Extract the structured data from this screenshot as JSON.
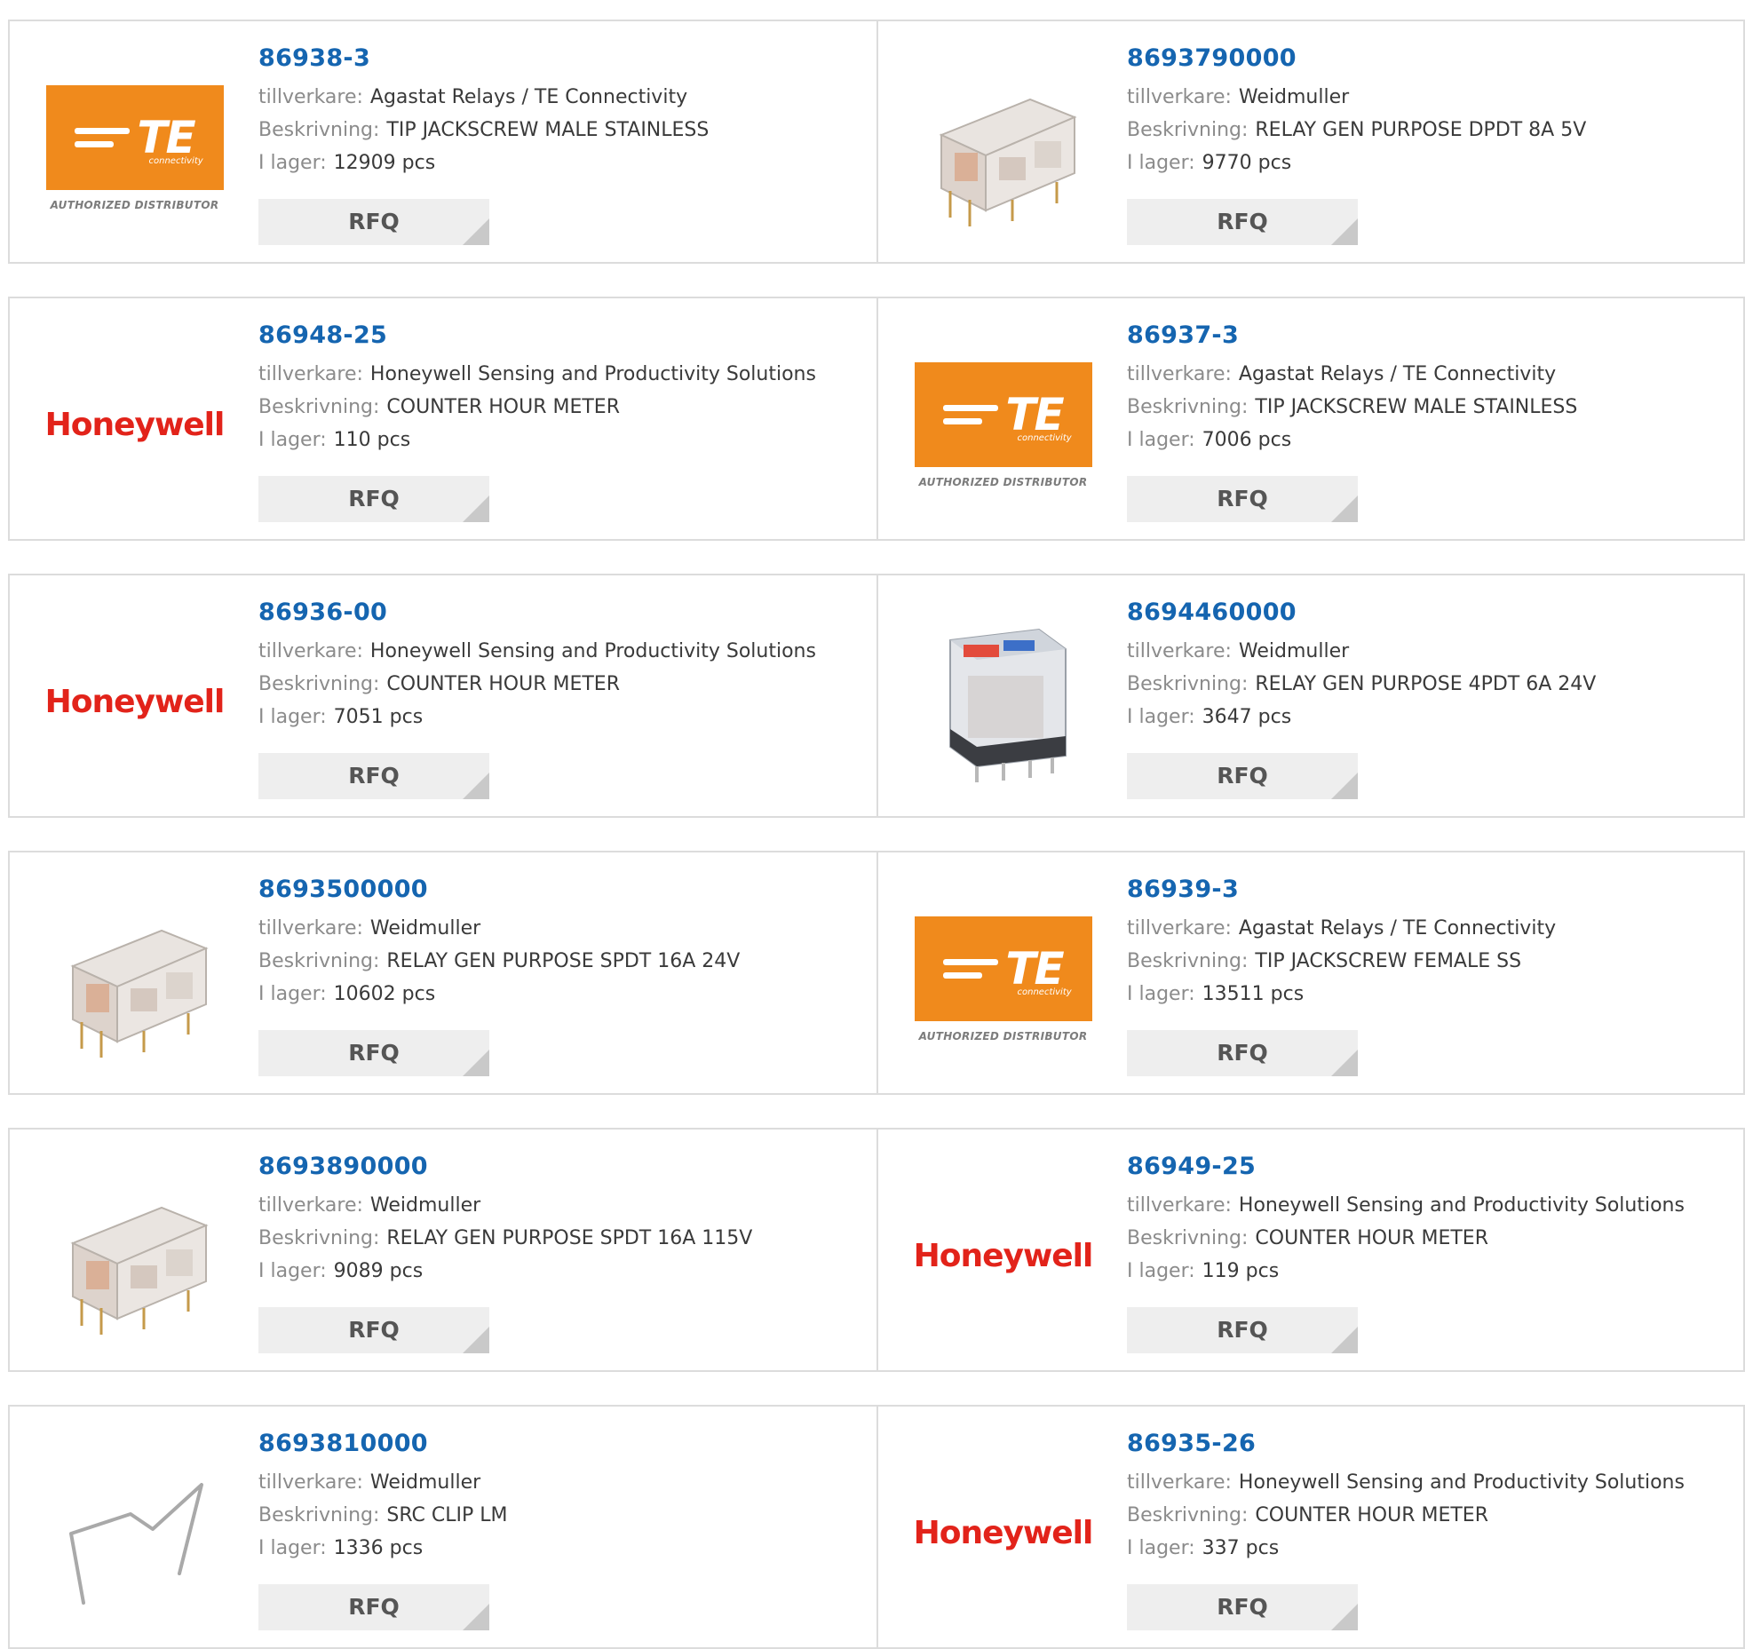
{
  "labels": {
    "manufacturer": "tillverkare:",
    "description": "Beskrivning:",
    "stock": "I lager:",
    "rfq": "RFQ"
  },
  "logos": {
    "te_text": "TE",
    "te_sub": "connectivity",
    "te_authorized": "AUTHORIZED DISTRIBUTOR",
    "honeywell": "Honeywell"
  },
  "products": [
    {
      "part": "86938-3",
      "manufacturer": "Agastat Relays / TE Connectivity",
      "description": "TIP JACKSCREW MALE STAINLESS",
      "stock": "12909 pcs",
      "image": "te-logo"
    },
    {
      "part": "8693790000",
      "manufacturer": "Weidmuller",
      "description": "RELAY GEN PURPOSE DPDT 8A 5V",
      "stock": "9770 pcs",
      "image": "relay-clear"
    },
    {
      "part": "86948-25",
      "manufacturer": "Honeywell Sensing and Productivity Solutions",
      "description": "COUNTER HOUR METER",
      "stock": "110 pcs",
      "image": "honeywell-logo"
    },
    {
      "part": "86937-3",
      "manufacturer": "Agastat Relays / TE Connectivity",
      "description": "TIP JACKSCREW MALE STAINLESS",
      "stock": "7006 pcs",
      "image": "te-logo"
    },
    {
      "part": "86936-00",
      "manufacturer": "Honeywell Sensing and Productivity Solutions",
      "description": "COUNTER HOUR METER",
      "stock": "7051 pcs",
      "image": "honeywell-logo"
    },
    {
      "part": "8694460000",
      "manufacturer": "Weidmuller",
      "description": "RELAY GEN PURPOSE 4PDT 6A 24V",
      "stock": "3647 pcs",
      "image": "relay-plugin"
    },
    {
      "part": "8693500000",
      "manufacturer": "Weidmuller",
      "description": "RELAY GEN PURPOSE SPDT 16A 24V",
      "stock": "10602 pcs",
      "image": "relay-clear"
    },
    {
      "part": "86939-3",
      "manufacturer": "Agastat Relays / TE Connectivity",
      "description": "TIP JACKSCREW FEMALE SS",
      "stock": "13511 pcs",
      "image": "te-logo"
    },
    {
      "part": "8693890000",
      "manufacturer": "Weidmuller",
      "description": "RELAY GEN PURPOSE SPDT 16A 115V",
      "stock": "9089 pcs",
      "image": "relay-clear"
    },
    {
      "part": "86949-25",
      "manufacturer": "Honeywell Sensing and Productivity Solutions",
      "description": "COUNTER HOUR METER",
      "stock": "119 pcs",
      "image": "honeywell-logo"
    },
    {
      "part": "8693810000",
      "manufacturer": "Weidmuller",
      "description": "SRC CLIP LM",
      "stock": "1336 pcs",
      "image": "wire-clip"
    },
    {
      "part": "86935-26",
      "manufacturer": "Honeywell Sensing and Productivity Solutions",
      "description": "COUNTER HOUR METER",
      "stock": "337 pcs",
      "image": "honeywell-logo"
    }
  ],
  "colors": {
    "part_link": "#1565b0",
    "te_orange": "#f08a1c",
    "honeywell_red": "#e2231a",
    "rfq_bg": "#eeeeee"
  }
}
